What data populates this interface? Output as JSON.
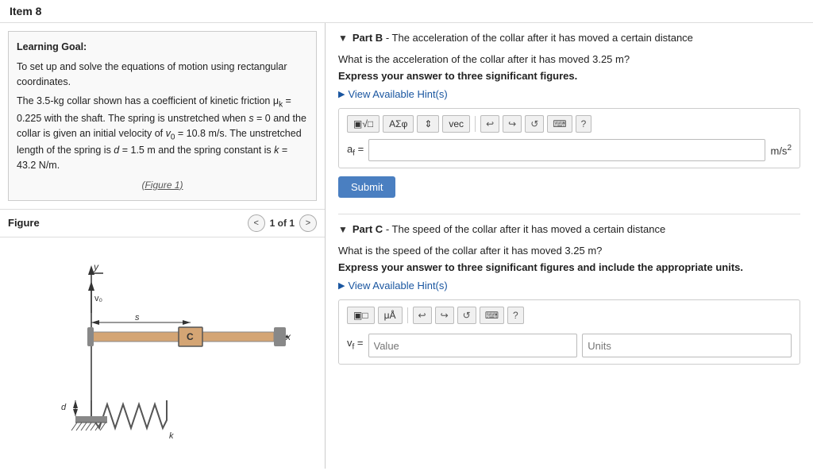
{
  "header": {
    "title": "Item 8"
  },
  "left": {
    "learning_goal_title": "Learning Goal:",
    "learning_goal_text1": "To set up and solve the equations of motion using rectangular coordinates.",
    "learning_goal_text2": "The 3.5-kg collar shown has a coefficient of kinetic friction μk = 0.225 with the shaft. The spring is unstretched when s = 0 and the collar is given an initial velocity of v₀ = 10.8 m/s. The unstretched length of the spring is d = 1.5 m and the spring constant is k = 43.2 N/m.",
    "figure_link": "(Figure 1)",
    "figure_label": "Figure",
    "page_indicator": "1 of 1",
    "nav_prev": "<",
    "nav_next": ">"
  },
  "right": {
    "part_b": {
      "label": "Part B",
      "description": "The acceleration of the collar after it has moved a certain distance",
      "question": "What is the acceleration of the collar after it has moved 3.25 m?",
      "emphasis": "Express your answer to three significant figures.",
      "hint_label": "View Available Hint(s)",
      "toolbar": {
        "btn1": "▣√□",
        "btn2": "ΑΣφ",
        "btn3": "↕",
        "btn4": "vec",
        "btn_undo": "↩",
        "btn_redo": "↪",
        "btn_refresh": "↺",
        "btn_keyboard": "⌨",
        "btn_help": "?"
      },
      "input_label": "af =",
      "unit": "m/s²",
      "submit_label": "Submit"
    },
    "part_c": {
      "label": "Part C",
      "description": "The speed of the collar after it has moved a certain distance",
      "question": "What is the speed of the collar after it has moved 3.25 m?",
      "emphasis": "Express your answer to three significant figures and include the appropriate units.",
      "hint_label": "View Available Hint(s)",
      "toolbar": {
        "btn1": "▣□",
        "btn2": "μÅ",
        "btn_undo": "↩",
        "btn_redo": "↪",
        "btn_refresh": "↺",
        "btn_keyboard": "⌨",
        "btn_help": "?"
      },
      "value_placeholder": "Value",
      "units_placeholder": "Units",
      "input_label": "vf ="
    }
  }
}
